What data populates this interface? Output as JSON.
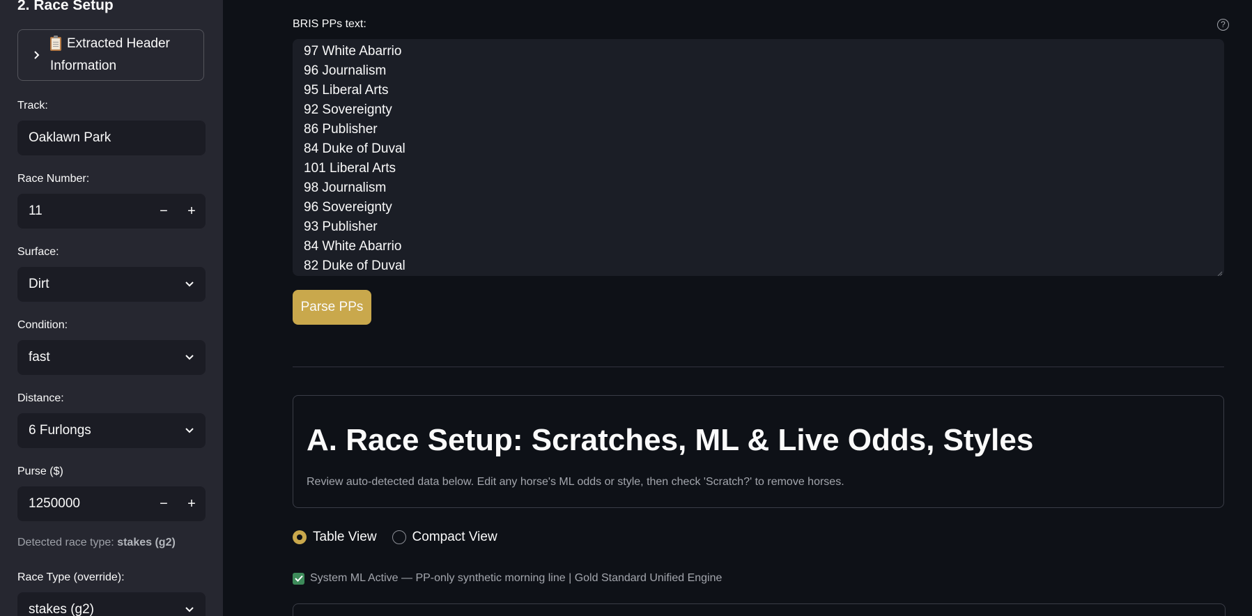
{
  "sidebar": {
    "heading": "2. Race Setup",
    "expander": {
      "line1": "Extracted Header",
      "line2": "Information",
      "icon": "clipboard-icon"
    },
    "track": {
      "label": "Track:",
      "value": "Oaklawn Park"
    },
    "race_number": {
      "label": "Race Number:",
      "value": "11",
      "minus": "−",
      "plus": "+"
    },
    "surface": {
      "label": "Surface:",
      "value": "Dirt"
    },
    "condition": {
      "label": "Condition:",
      "value": "fast"
    },
    "distance": {
      "label": "Distance:",
      "value": "6 Furlongs"
    },
    "purse": {
      "label": "Purse ($)",
      "value": "1250000",
      "minus": "−",
      "plus": "+"
    },
    "detected_prefix": "Detected race type:",
    "detected_value": "stakes (g2)",
    "race_type": {
      "label": "Race Type (override):",
      "value": "stakes (g2)"
    }
  },
  "main": {
    "pp_label": "BRIS PPs text:",
    "help": "?",
    "pp_lines": [
      "97 White Abarrio",
      "96 Journalism",
      "95 Liberal Arts",
      "92 Sovereignty",
      "86 Publisher",
      "84 Duke of Duval",
      "101 Liberal Arts",
      "98 Journalism",
      "96 Sovereignty",
      "93 Publisher",
      "84 White Abarrio",
      "82 Duke of Duval"
    ],
    "parse_button": "Parse PPs",
    "section_title": "A. Race Setup: Scratches, ML & Live Odds, Styles",
    "section_desc": "Review auto-detected data below. Edit any horse's ML odds or style, then check 'Scratch?' to remove horses.",
    "view_options": [
      "Table View",
      "Compact View"
    ],
    "selected_view": "Table View",
    "status_text": "System ML Active — PP-only synthetic morning line | Gold Standard Unified Engine"
  },
  "colors": {
    "accent": "#c9a84c",
    "background": "#0e1117",
    "sidebar": "#262730",
    "success": "#3d8b5a"
  }
}
